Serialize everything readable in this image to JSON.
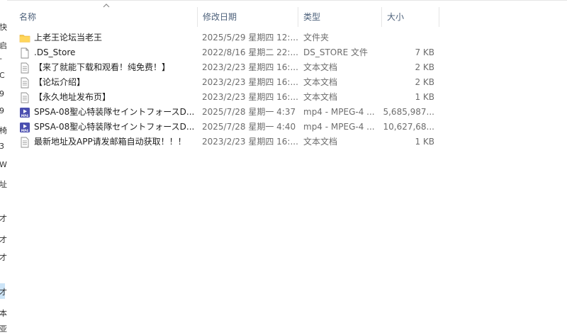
{
  "nav": {
    "glyphs": [
      "快",
      "启",
      "-",
      "C",
      "9",
      "9",
      "椅",
      "3",
      "W",
      "址",
      "才",
      "才",
      "才",
      "才",
      "本",
      "亚"
    ]
  },
  "header": {
    "name": "名称",
    "date": "修改日期",
    "type": "类型",
    "size": "大小"
  },
  "files": [
    {
      "name": "上老王论坛当老王",
      "date": "2025/5/29 星期四 12:...",
      "type": "文件夹",
      "size": "",
      "icon": "folder-icon"
    },
    {
      "name": ".DS_Store",
      "date": "2022/8/16 星期二 22:...",
      "type": "DS_STORE 文件",
      "size": "7 KB",
      "icon": "file-icon"
    },
    {
      "name": "【来了就能下载和观看！纯免费！】",
      "date": "2023/2/23 星期四 16:...",
      "type": "文本文档",
      "size": "2 KB",
      "icon": "text-document-icon"
    },
    {
      "name": "【论坛介绍】",
      "date": "2023/2/23 星期四 16:...",
      "type": "文本文档",
      "size": "2 KB",
      "icon": "text-document-icon"
    },
    {
      "name": "【永久地址发布页】",
      "date": "2023/2/23 星期四 16:...",
      "type": "文本文档",
      "size": "1 KB",
      "icon": "text-document-icon"
    },
    {
      "name": "SPSA-08聖心特装隊セイントフォースD...",
      "date": "2025/7/28 星期一 4:37",
      "type": "mp4 - MPEG-4 ...",
      "size": "5,685,987...",
      "icon": "video-file-icon"
    },
    {
      "name": "SPSA-08聖心特装隊セイントフォースD...",
      "date": "2025/7/28 星期一 4:40",
      "type": "mp4 - MPEG-4 ...",
      "size": "10,627,68...",
      "icon": "video-file-icon"
    },
    {
      "name": "最新地址及APP请发邮箱自动获取！！！",
      "date": "2023/2/23 星期四 16:...",
      "type": "文本文档",
      "size": "1 KB",
      "icon": "text-document-icon"
    }
  ]
}
